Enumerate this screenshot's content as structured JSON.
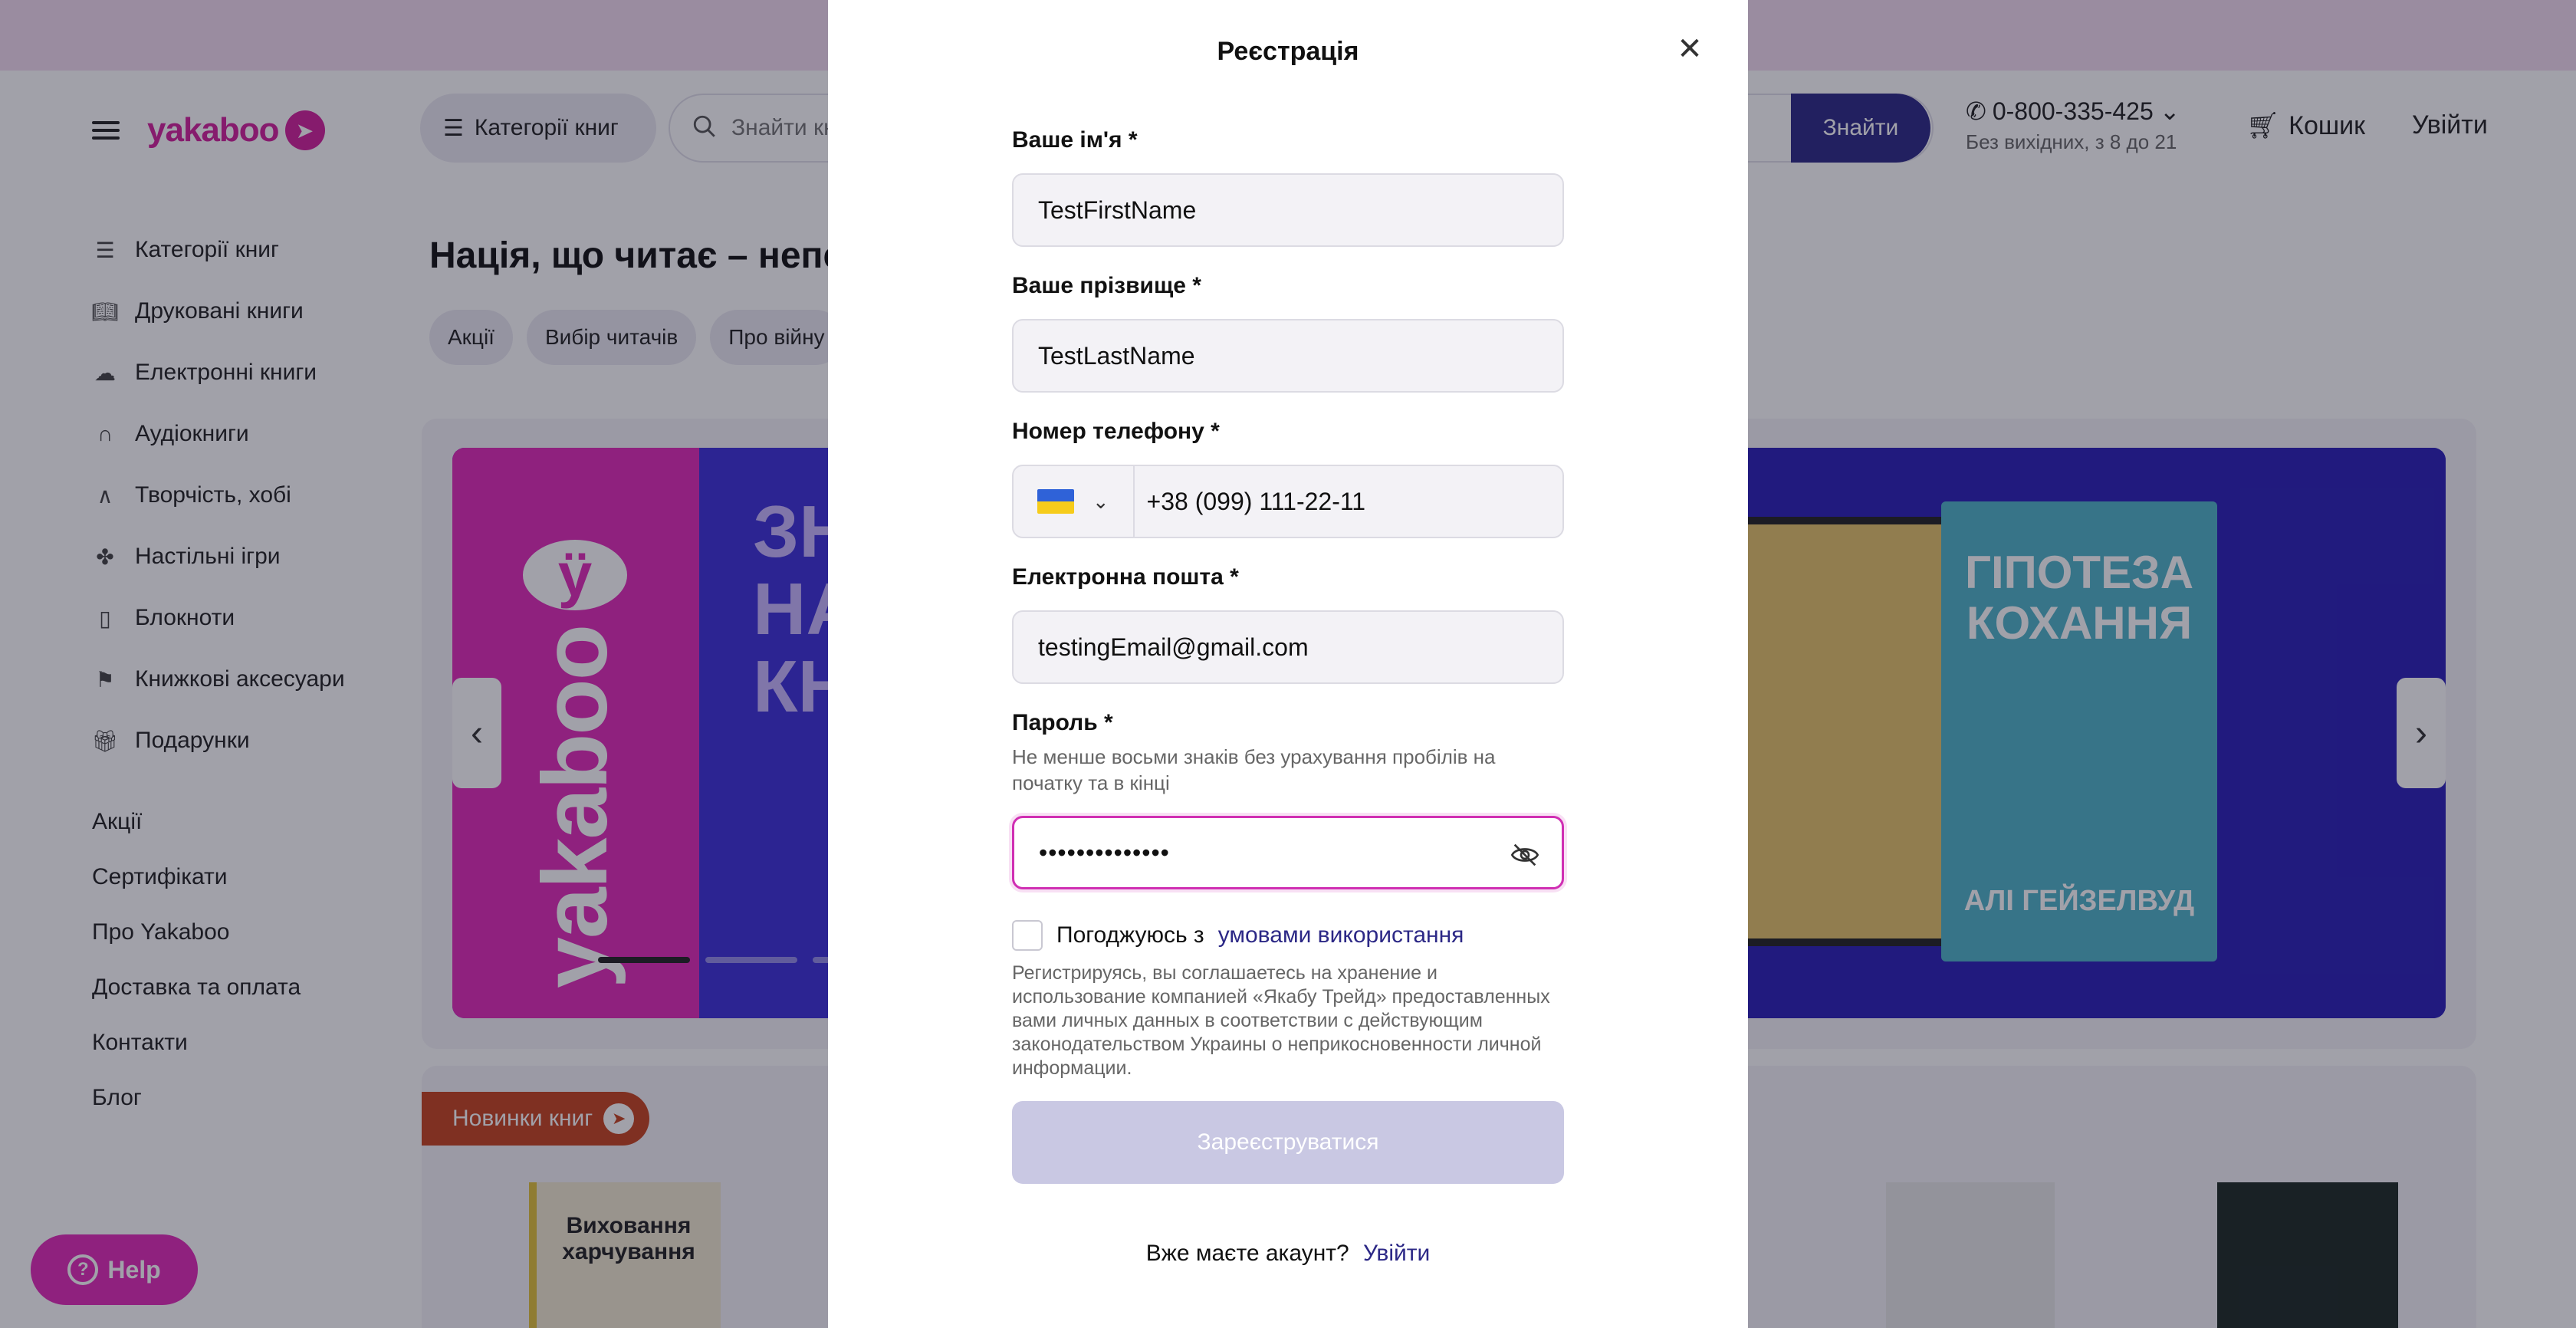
{
  "header": {
    "logo_text": "yakaboo",
    "categories_label": "Категорії книг",
    "search_placeholder": "Знайти книгу",
    "search_button": "Знайти",
    "phone_number": "0-800-335-425",
    "phone_hours": "Без вихідних, з 8 до 21",
    "cart_label": "Кошик",
    "login_label": "Увійти"
  },
  "sidebar": {
    "items": [
      {
        "label": "Категорії книг",
        "icon": "list-icon"
      },
      {
        "label": "Друковані книги",
        "icon": "book-icon"
      },
      {
        "label": "Електронні книги",
        "icon": "cloud-icon"
      },
      {
        "label": "Аудіокниги",
        "icon": "headphones-icon"
      },
      {
        "label": "Творчість, хобі",
        "icon": "brush-icon"
      },
      {
        "label": "Настільні ігри",
        "icon": "game-icon"
      },
      {
        "label": "Блокноти",
        "icon": "notebook-icon"
      },
      {
        "label": "Книжкові аксесуари",
        "icon": "bookmark-icon"
      },
      {
        "label": "Подарунки",
        "icon": "gift-icon"
      }
    ],
    "links": [
      "Акції",
      "Сертифікати",
      "Про Yakaboo",
      "Доставка та оплата",
      "Контакти",
      "Блог"
    ]
  },
  "main": {
    "title": "Нація, що читає – непер",
    "chips": [
      "Акції",
      "Вибір читачів",
      "Про війну"
    ],
    "banner": {
      "big_text": "ЗН\nНА\nКН",
      "book_title": "ГІПОТЕЗА КОХАННЯ",
      "book_author": "АЛІ ГЕЙЗЕЛВУД"
    },
    "news_badge": "Новинки книг",
    "thumb1_title": "Виховання харчування"
  },
  "help_label": "Help",
  "modal": {
    "title": "Реєстрація",
    "first_name_label": "Ваше ім'я *",
    "first_name_value": "TestFirstName",
    "last_name_label": "Ваше прізвище *",
    "last_name_value": "TestLastName",
    "phone_label": "Номер телефону *",
    "phone_value": "+38 (099) 111-22-11",
    "email_label": "Електронна пошта *",
    "email_value": "testingEmail@gmail.com",
    "password_label": "Пароль *",
    "password_hint": "Не менше восьми знаків без урахування пробілів на початку та в кінці",
    "password_value": "••••••••••••••",
    "agree_prefix": "Погоджуюсь з",
    "agree_link": "умовами використання",
    "legal_text": "Регистрируясь, вы соглашаетесь на хранение и использование компанией «Якабу Трейд» предоставленных вами личных данных в соответствии с действующим законодательством Украины о неприкосновенности личной информации.",
    "submit_label": "Зареєструватися",
    "have_account": "Вже маєте акаунт?",
    "login_link": "Увійти"
  },
  "colors": {
    "brand_pink": "#d3219b",
    "accent_navy": "#2c2886",
    "focus_border": "#d02fb3",
    "disabled_button": "#c9c8e3"
  }
}
